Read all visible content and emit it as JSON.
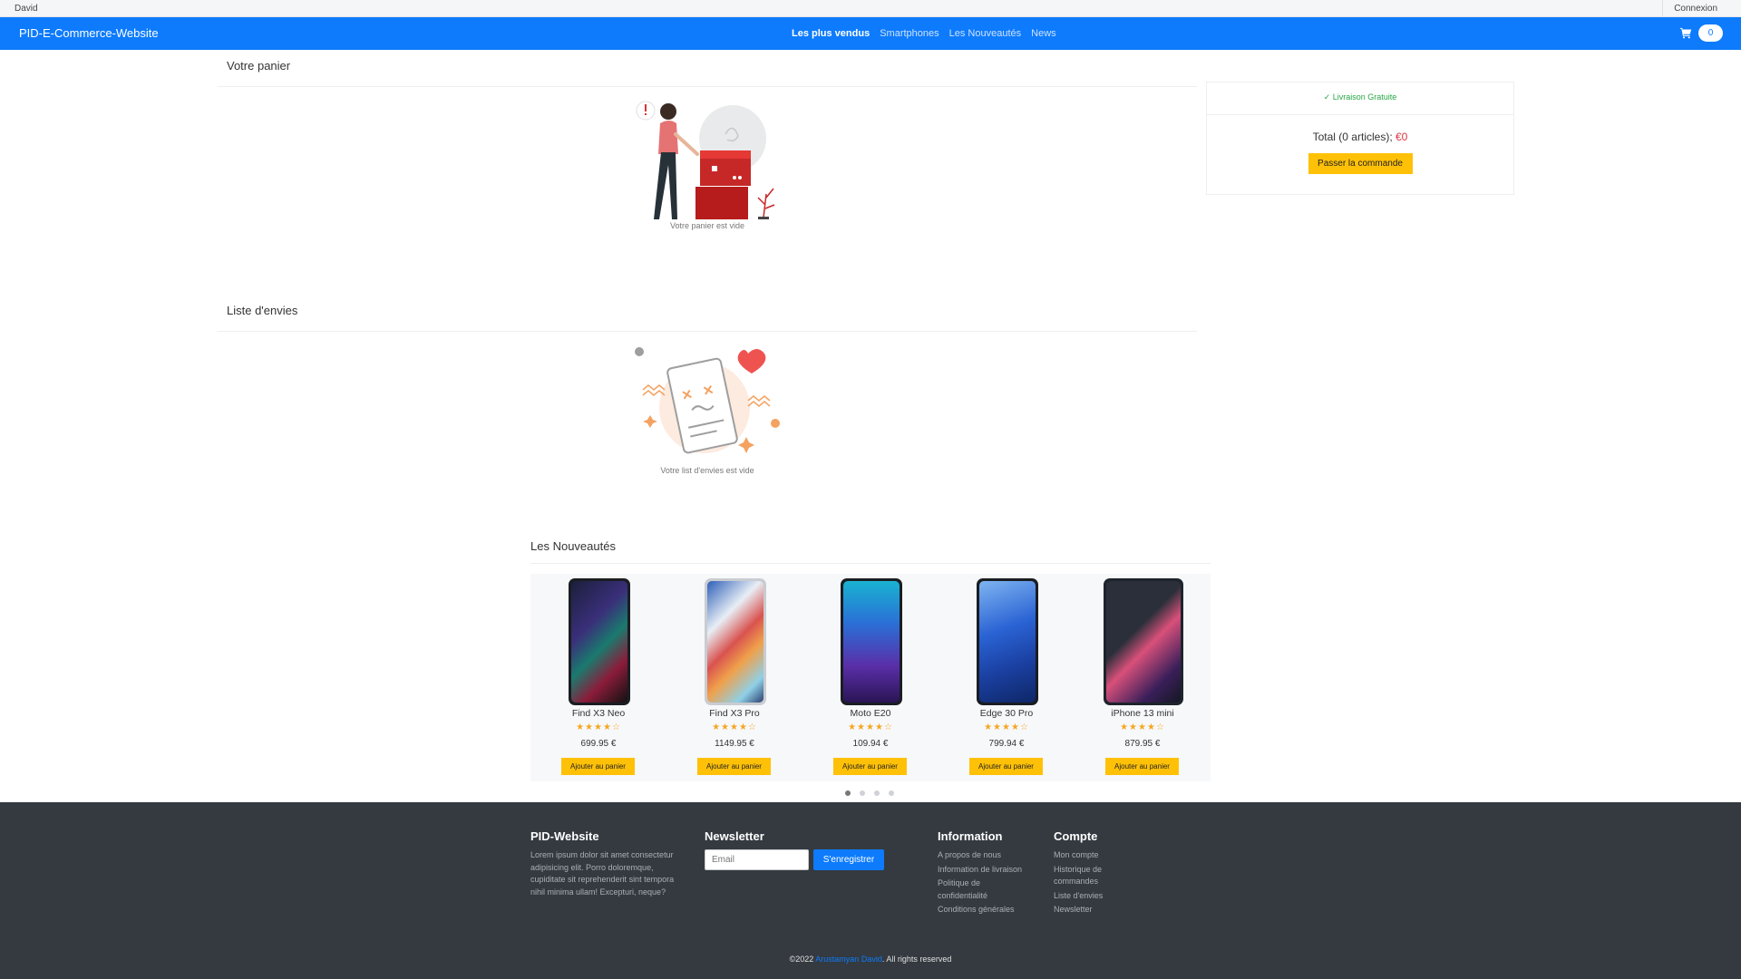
{
  "topbar": {
    "user": "David",
    "login": "Connexion"
  },
  "navbar": {
    "brand": "PID-E-Commerce-Website",
    "links": [
      "Les plus vendus",
      "Smartphones",
      "Les Nouveautés",
      "News"
    ],
    "cart_count": "0"
  },
  "cart": {
    "title": "Votre panier",
    "empty_text": "Votre panier est vide"
  },
  "summary": {
    "shipping": "Livraison Gratuite",
    "total_label": "Total (0 articles);",
    "total_amount": "€0",
    "order_button": "Passer la commande"
  },
  "wishlist": {
    "title": "Liste d'envies",
    "empty_text": "Votre list d'envies est vide"
  },
  "new_products": {
    "title": "Les Nouveautés",
    "items": [
      {
        "name": "Find X3 Neo",
        "rating": "★★★★☆",
        "price": "699.95 €",
        "button": "Ajouter au panier"
      },
      {
        "name": "Find X3 Pro",
        "rating": "★★★★☆",
        "price": "1149.95 €",
        "button": "Ajouter au panier"
      },
      {
        "name": "Moto E20",
        "rating": "★★★★☆",
        "price": "109.94 €",
        "button": "Ajouter au panier"
      },
      {
        "name": "Edge 30 Pro",
        "rating": "★★★★☆",
        "price": "799.94 €",
        "button": "Ajouter au panier"
      },
      {
        "name": "iPhone 13 mini",
        "rating": "★★★★☆",
        "price": "879.95 €",
        "button": "Ajouter au panier"
      }
    ],
    "carousel_pages": 4,
    "active_page": 1
  },
  "footer": {
    "about_title": "PID-Website",
    "about_text": "Lorem ipsum dolor sit amet consectetur adipisicing elit. Porro doloremque, cupiditate sit reprehenderit sint tempora nihil minima ullam! Excepturi, neque?",
    "newsletter_title": "Newsletter",
    "email_placeholder": "Email",
    "subscribe_button": "S'enregistrer",
    "info_title": "Information",
    "info_links": [
      "A propos de nous",
      "Information de livraison",
      "Politique de confidentialité",
      "Conditions générales"
    ],
    "account_title": "Compte",
    "account_links": [
      "Mon compte",
      "Historique de commandes",
      "Liste d'envies",
      "Newsletter"
    ],
    "copyright_prefix": "©2022",
    "copyright_author": "Arustamyan David",
    "copyright_suffix": ". All rights reserved"
  },
  "colors": {
    "primary": "#0d7bfc",
    "button": "#ffc107",
    "footer": "#343a40",
    "price_red": "#dc3545",
    "success": "#28a745"
  }
}
